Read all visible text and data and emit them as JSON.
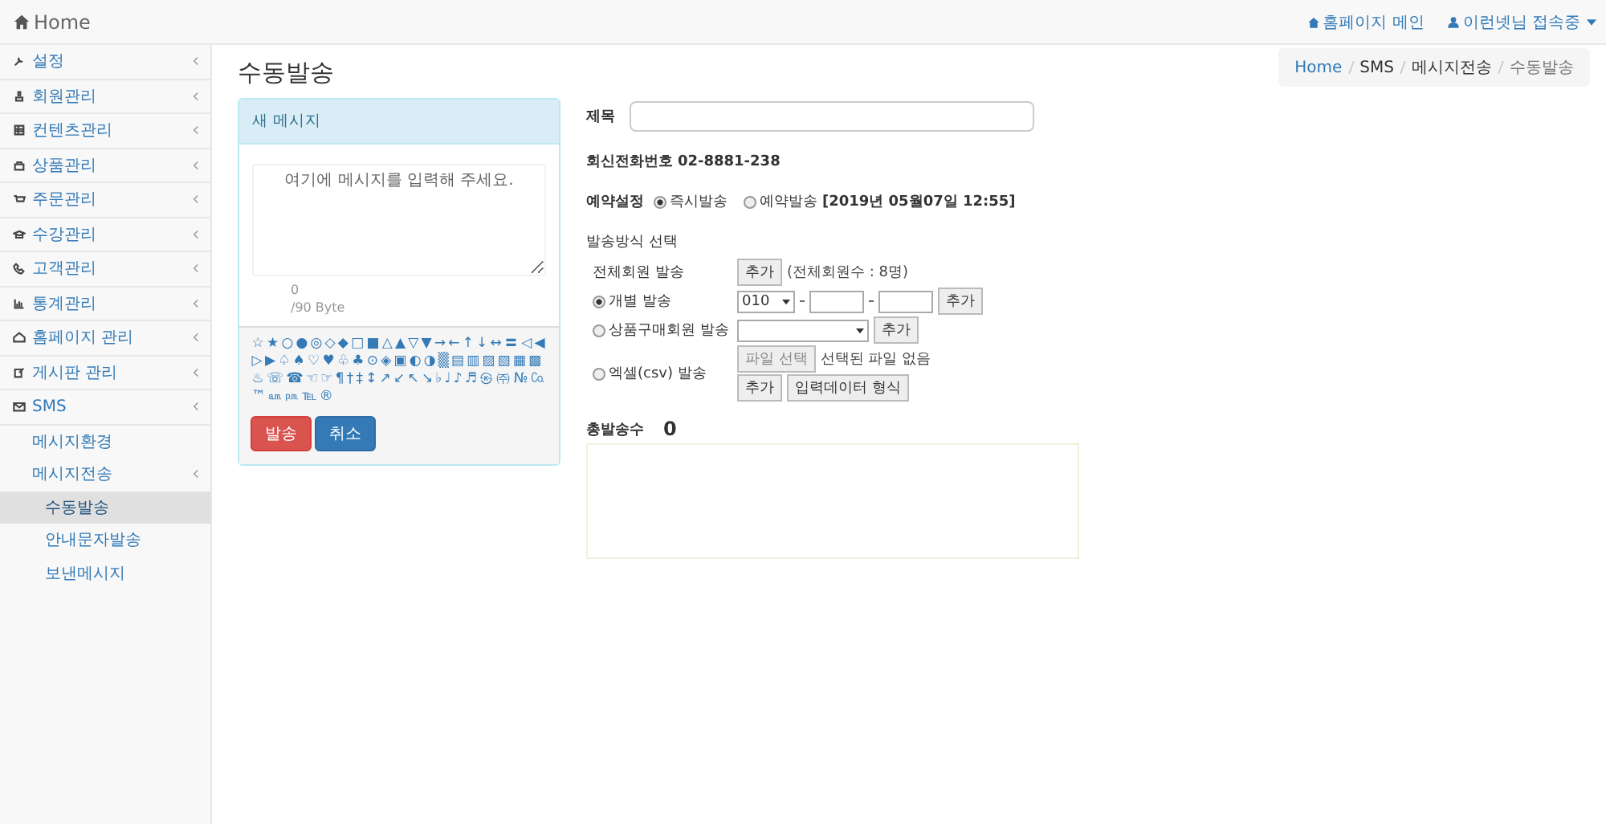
{
  "navbar": {
    "brand": "Home",
    "links": [
      "홈페이지 메인",
      "이런넷님 접속중"
    ]
  },
  "sidebar": {
    "items": [
      {
        "label": "설정",
        "selected": false
      },
      {
        "label": "회원관리",
        "selected": false
      },
      {
        "label": "컨텐츠관리",
        "selected": false
      },
      {
        "label": "상품관리",
        "selected": false
      },
      {
        "label": "주문관리",
        "selected": false
      },
      {
        "label": "수강관리",
        "selected": false
      },
      {
        "label": "고객관리",
        "selected": false
      },
      {
        "label": "통계관리",
        "selected": false
      },
      {
        "label": "홈페이지 관리",
        "selected": false
      },
      {
        "label": "게시판 관리",
        "selected": false
      },
      {
        "label": "SMS",
        "selected": false,
        "children": [
          {
            "label": "메시지환경",
            "selected": false
          },
          {
            "label": "메시지전송",
            "selected": false,
            "children": [
              {
                "label": "수동발송",
                "selected": true
              },
              {
                "label": "안내문자발송",
                "selected": false
              },
              {
                "label": "보낸메시지",
                "selected": false
              }
            ]
          }
        ]
      }
    ]
  },
  "page_title": "수동발송",
  "breadcrumb": [
    "Home",
    "SMS",
    "메시지전송",
    "수동발송"
  ],
  "message_panel": {
    "header": "새 메시지",
    "placeholder": "여기에 메시지를 입력해 주세요.",
    "byte_count": "0",
    "byte_limit": "/90 Byte",
    "symbols": [
      "☆",
      "★",
      "○",
      "●",
      "◎",
      "◇",
      "◆",
      "□",
      "■",
      "△",
      "▲",
      "▽",
      "▼",
      "→",
      "←",
      "↑",
      "↓",
      "↔",
      "〓",
      "◁",
      "◀",
      "▷",
      "▶",
      "♤",
      "♠",
      "♡",
      "♥",
      "♧",
      "♣",
      "⊙",
      "◈",
      "▣",
      "◐",
      "◑",
      "▒",
      "▤",
      "▥",
      "▨",
      "▧",
      "▦",
      "▩",
      "♨",
      "☏",
      "☎",
      "☜",
      "☞",
      "¶",
      "†",
      "‡",
      "↕",
      "↗",
      "↙",
      "↖",
      "↘",
      "♭",
      "♩",
      "♪",
      "♬",
      "㉿",
      "㈜",
      "№",
      "㏇",
      "™",
      "㏂",
      "㏘",
      "℡",
      "®"
    ],
    "buttons": [
      {
        "label": "발송",
        "kind": "danger"
      },
      {
        "label": "취소",
        "kind": "primary"
      }
    ]
  },
  "form": {
    "subject_label": "제목",
    "callback_label": "회신전화번호",
    "callback_number": "02-8881-238",
    "reservation": {
      "label": "예약설정",
      "options": [
        {
          "label": "즉시발송",
          "selected": true
        },
        {
          "label": "예약발송",
          "detail": "[2019년 05월07일 12:55]",
          "selected": false
        }
      ]
    },
    "send_method": {
      "title": "발송방식 선택",
      "rows": [
        {
          "kind": "all",
          "label": "전체회원 발송",
          "button": "추가",
          "note": "(전체회원수 : 8명)"
        },
        {
          "kind": "individual",
          "label": "개별 발송",
          "selected": true,
          "prefix": "010",
          "button": "추가"
        },
        {
          "kind": "product",
          "label": "상품구매회원 발송",
          "selected": false,
          "button": "추가"
        },
        {
          "kind": "csv",
          "label": "엑셀(csv) 발송",
          "selected": false,
          "file_button": "파일 선택",
          "file_status": "선택된 파일 없음",
          "buttons": [
            "추가",
            "입력데이터 형식"
          ]
        }
      ]
    },
    "total_label": "총발송수",
    "total": "0"
  }
}
